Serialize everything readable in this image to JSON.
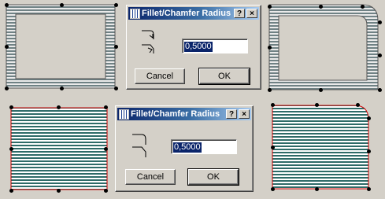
{
  "colors": {
    "desktop": "#d4d0c8",
    "window_face": "#d4d0c8",
    "titlebar_start": "#0a246a",
    "titlebar_end": "#a6caf0",
    "hatch_gray": "#6f8184",
    "hatch_teal": "#2e6b68",
    "outline_red": "#cc0000",
    "selection": "#0a246a"
  },
  "dialog_top": {
    "title": "Fillet/Chamfer Radius",
    "help_button": "?",
    "close_button": "×",
    "radius_value": "0,5000",
    "cancel_label": "Cancel",
    "ok_label": "OK",
    "icons": [
      "fillet-corner-icon",
      "chamfer-corner-icon"
    ]
  },
  "dialog_bottom": {
    "title": "Fillet/Chamfer Radius",
    "help_button": "?",
    "close_button": "×",
    "radius_value": "0,5000",
    "cancel_label": "Cancel",
    "ok_label": "OK",
    "icons": [
      "fillet-corner-icon",
      "chamfer-corner-icon"
    ]
  }
}
